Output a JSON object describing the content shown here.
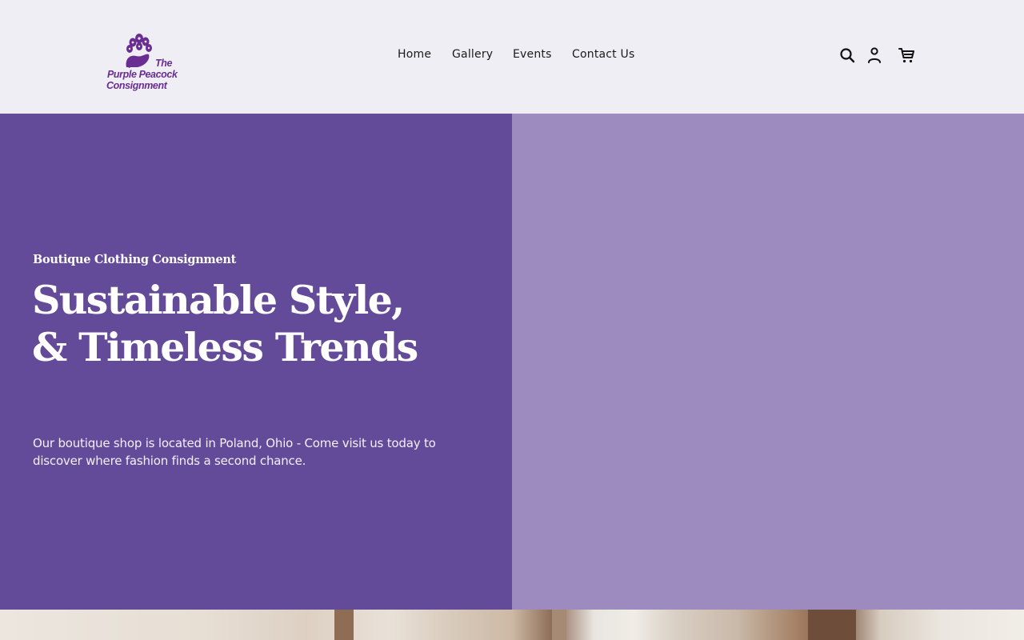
{
  "brand": {
    "logo_line1": "The",
    "logo_line2": "Purple Peacock",
    "logo_line3": "Consignment",
    "color": "#6a2d91"
  },
  "nav": {
    "items": [
      {
        "label": "Home"
      },
      {
        "label": "Gallery"
      },
      {
        "label": "Events"
      },
      {
        "label": "Contact Us"
      }
    ]
  },
  "header_icons": [
    "search-icon",
    "account-icon",
    "cart-icon"
  ],
  "hero": {
    "eyebrow": "Boutique Clothing Consignment",
    "headline_line1": "Sustainable Style,",
    "headline_line2": "& Timeless Trends",
    "description": "Our boutique shop is located in Poland, Ohio - Come visit us today to discover where fashion finds a second chance.",
    "left_color": "#634b99",
    "right_color": "#9d8abf"
  }
}
